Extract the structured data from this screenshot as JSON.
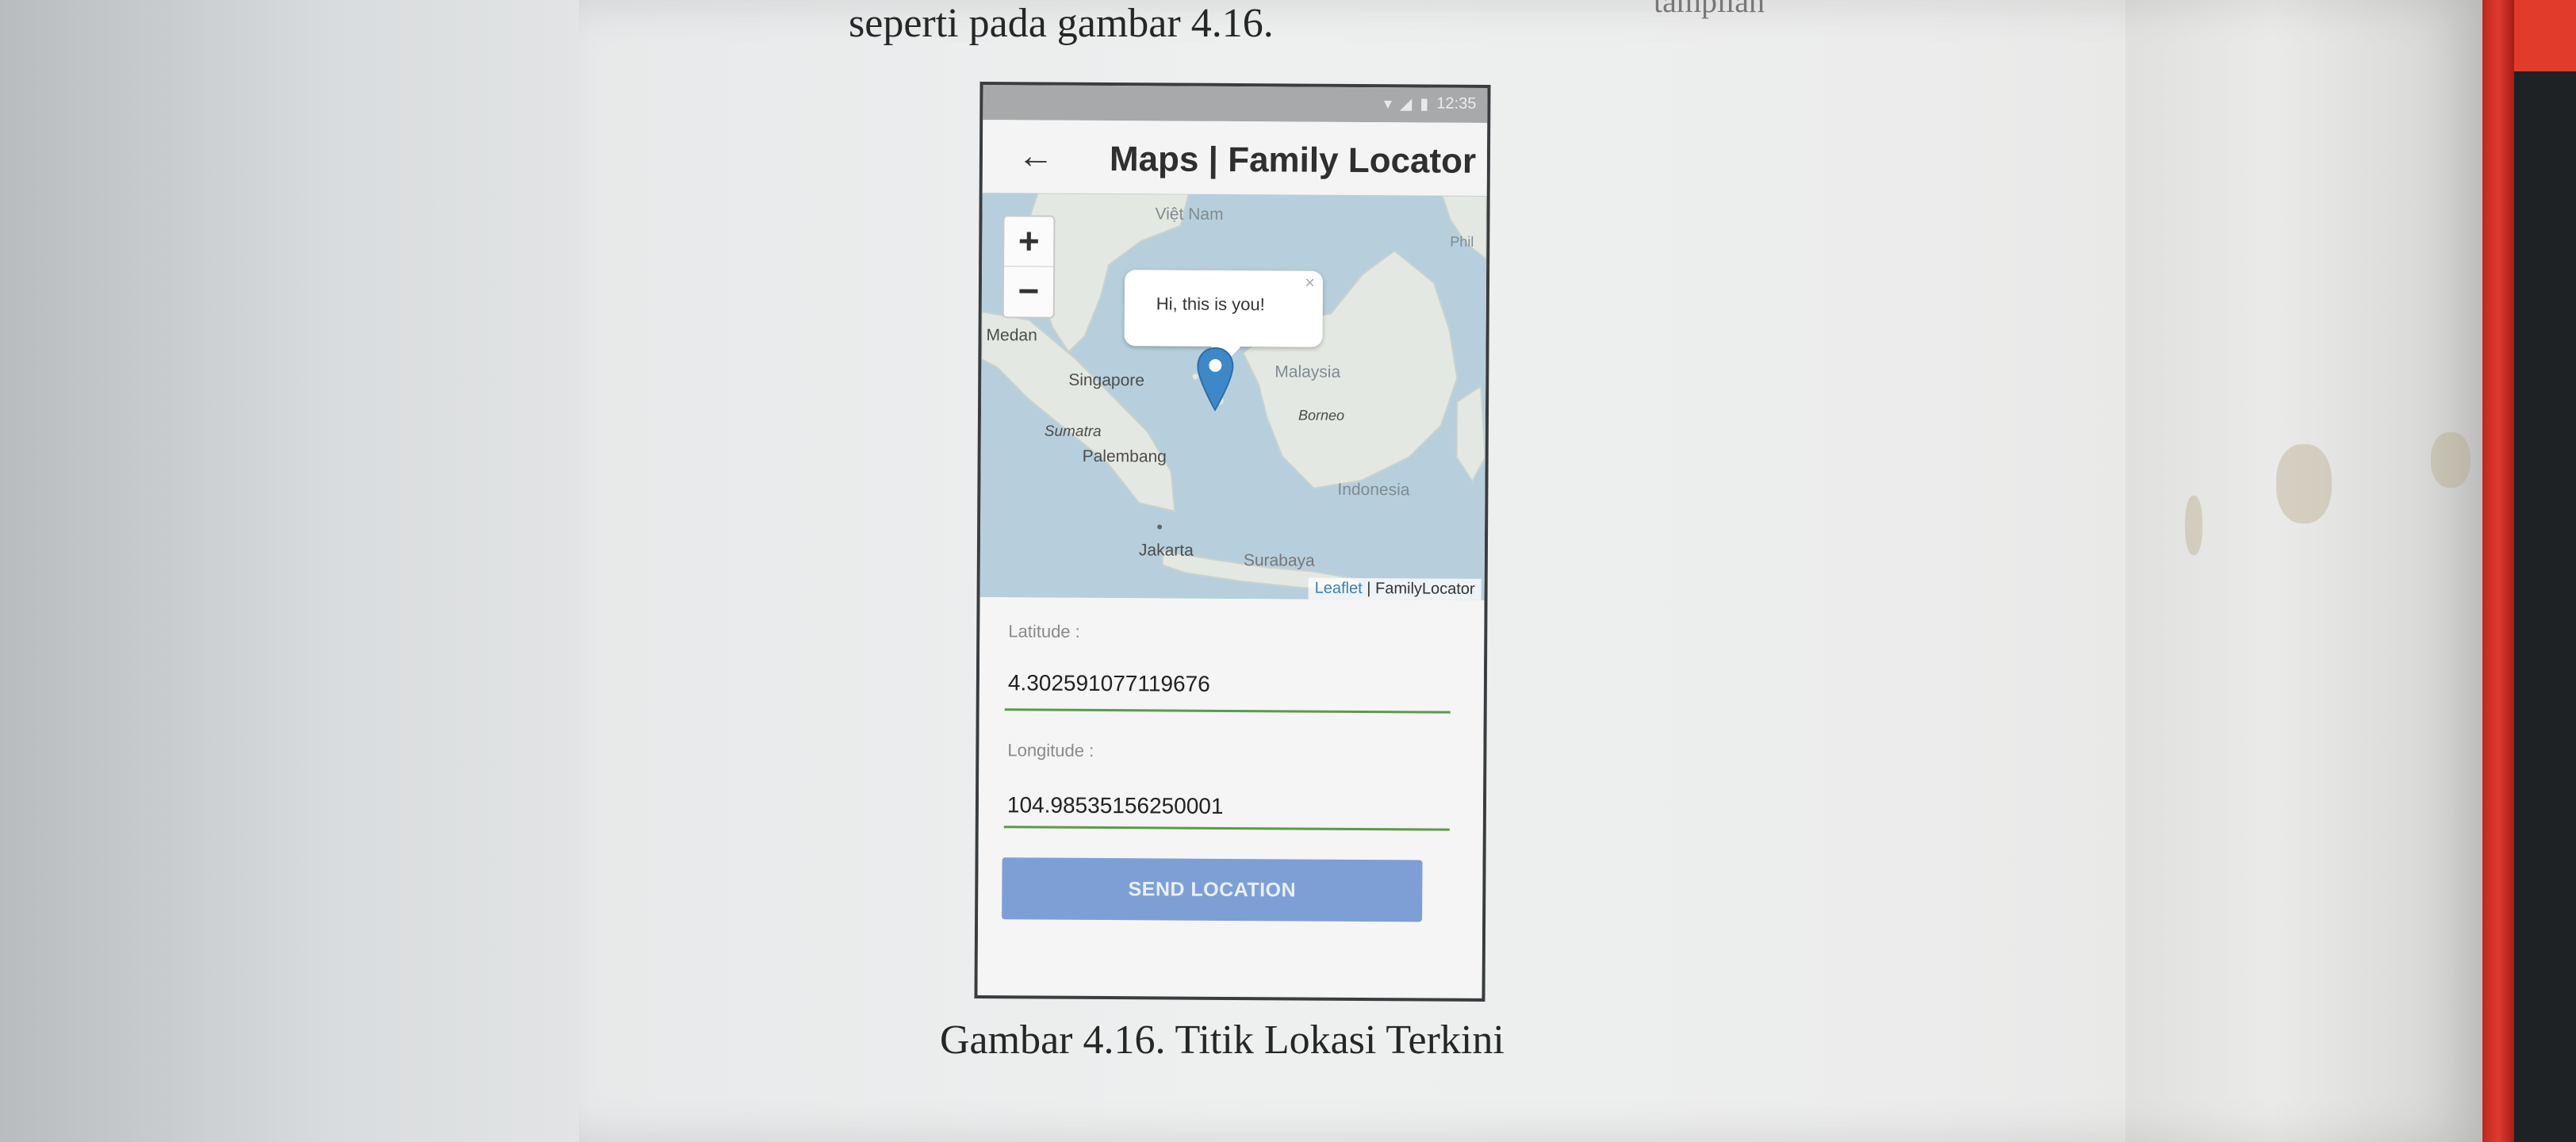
{
  "document": {
    "top_line": "seperti pada gambar 4.16.",
    "top_right_fragment": "tampilan",
    "caption": "Gambar 4.16. Titik Lokasi Terkini"
  },
  "status_bar": {
    "time": "12:35"
  },
  "app_bar": {
    "title": "Maps | Family Locator",
    "back_icon": "arrow-left-icon"
  },
  "map": {
    "zoom_in_label": "+",
    "zoom_out_label": "−",
    "labels": {
      "vietnam": "Việt Nam",
      "phil": "Phil",
      "medan": "Medan",
      "singapore": "Singapore",
      "malaysia": "Malaysia",
      "borneo": "Borneo",
      "sumatra": "Sumatra",
      "palembang": "Palembang",
      "indonesia": "Indonesia",
      "jakarta": "Jakarta",
      "surabaya": "Surabaya"
    },
    "popup": {
      "text": "Hi, this is you!",
      "close": "×"
    },
    "marker_icon": "map-pin-icon",
    "attribution": {
      "leaflet": "Leaflet",
      "separator": " | ",
      "source": "FamilyLocator"
    },
    "colors": {
      "sea": "#b7cfdc",
      "land": "#e4e8e2",
      "marker": "#3f88c8"
    }
  },
  "form": {
    "latitude_label": "Latitude :",
    "latitude_value": "4.302591077119676",
    "longitude_label": "Longitude :",
    "longitude_value": "104.98535156250001",
    "send_button": "SEND LOCATION",
    "underline_color": "#5a9b4a",
    "button_color": "#7e9fd6"
  }
}
